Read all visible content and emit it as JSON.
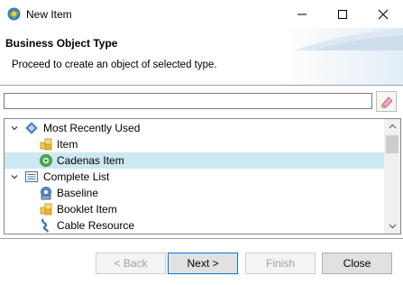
{
  "window": {
    "title": "New Item",
    "icon": "app-icon",
    "controls": [
      "minimize-icon",
      "maximize-icon",
      "close-icon"
    ]
  },
  "banner": {
    "title": "Business Object Type",
    "description": "Proceed to create an object of selected type."
  },
  "filter": {
    "value": "",
    "placeholder": "",
    "clear_icon": "eraser-icon"
  },
  "tree": {
    "rows": [
      {
        "label": "Most Recently Used",
        "level": 0,
        "expanded": true,
        "icon": "diamond-folder-icon"
      },
      {
        "label": "Item",
        "level": 1,
        "icon": "item-cubes-icon"
      },
      {
        "label": "Cadenas Item",
        "level": 1,
        "icon": "cadenas-icon",
        "selected": true
      },
      {
        "label": "Complete List",
        "level": 0,
        "expanded": true,
        "icon": "list-icon"
      },
      {
        "label": "Baseline",
        "level": 1,
        "icon": "baseline-icon"
      },
      {
        "label": "Booklet Item",
        "level": 1,
        "icon": "item-cubes-icon"
      },
      {
        "label": "Cable Resource",
        "level": 1,
        "icon": "cable-icon"
      }
    ]
  },
  "buttons": {
    "back": "< Back",
    "next": "Next >",
    "finish": "Finish",
    "close": "Close"
  },
  "colors": {
    "selection": "#cce8f0",
    "default_button_border": "#0078d7"
  }
}
